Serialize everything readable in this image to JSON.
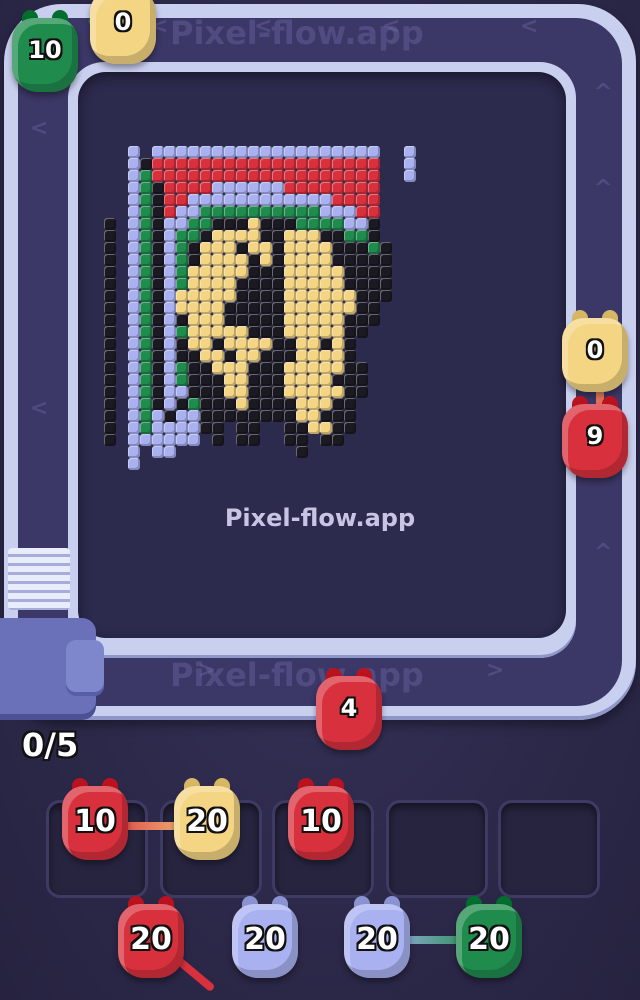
{
  "watermark": "Pixel-flow.app",
  "lane_text": "Pixel-flow.app",
  "chevrons": {
    "left": "<",
    "right": ">",
    "up": "^"
  },
  "progress": {
    "text": "0/5",
    "collected": 0,
    "total": 5
  },
  "colors": {
    "red": "#d8313d",
    "yellow": "#f4d583",
    "green": "#1f8b4d",
    "blue": "#a9b1f0",
    "black": "#1b1a22",
    "track": "#c9cfee",
    "board": "#2c2a4d"
  },
  "conveyor_pigs": [
    {
      "id": "top-yellow",
      "color": "yellow",
      "count": "0"
    },
    {
      "id": "top-green",
      "color": "green",
      "count": "10"
    },
    {
      "id": "right-yellow",
      "color": "yellow",
      "count": "0"
    },
    {
      "id": "right-red",
      "color": "red",
      "count": "9"
    },
    {
      "id": "bottom-red",
      "color": "red",
      "count": "4"
    }
  ],
  "slots": [
    {
      "pig": {
        "color": "red",
        "count": "10"
      }
    },
    {
      "pig": {
        "color": "yellow",
        "count": "20"
      }
    },
    {
      "pig": {
        "color": "red",
        "count": "10"
      }
    },
    {
      "pig": null
    },
    {
      "pig": null
    }
  ],
  "queue": [
    {
      "color": "red",
      "count": "20"
    },
    {
      "color": "blue",
      "count": "20"
    },
    {
      "color": "blue",
      "count": "20"
    },
    {
      "color": "green",
      "count": "20"
    }
  ],
  "pixel_art": {
    "palette": {
      "R": "red",
      "Y": "yellow",
      "G": "green",
      "B": "blue",
      "K": "black"
    },
    "rows": [
      "..B.BBBBBBBBBBBBBBBBBBB..B",
      "..BKRRRRRRRRRRRRRRRRRRR..B",
      "..BGRRRRRRRRRRRRRRRRRRR..B",
      "..BGKRRRRBBBBBBRRRRRRRR...",
      "..BGKRRBBBBBBBBBBBBRRRR...",
      "..BGKRBBGGGGGGGGGGBBBRR...",
      "K.BGKBBGGKKKYKKKGGGGBBK...",
      "K.BGKBGGKYYYYKKYYYKKGGK...",
      "K.BGKBGKYYYKYYKYYYYKKKGK..",
      "K.BGKBGKYYYYKYKYYYYKKKKK..",
      "K.BGKBGYYYYYKKKYYYYYKKKK..",
      "K.BGKBGYYYYKKKKYYYYYKKKK..",
      "K.BGKBYYYYYKKKKYYYYYYKKK..",
      "K.BGKBYYYYKKKKKYYYYYYKK...",
      "K.BGKBKYYYKKKKKYYYYYKKK...",
      "K.BGKBGYYYYYKKKYYYYYKK....",
      "K.BGKBKYYKYYYYKKYYKYK.....",
      "K.BGKBKKYYKYYKKKYYYYK.....",
      "K.BGKBGKKYYYKKKYYYYYKK....",
      "K.BGKBGKKKYYKKKYYYYKKK....",
      "K.BGKBBKKKYYKKKYYYYYKK....",
      "K.BGKBKGKKKYKKKKYYYKK.....",
      "K.BGBKBBKKKKKKKKYYKKK.....",
      "K.BGBBBBKK.KK..KKYYKK.....",
      "K.BBBBBB.K.KK..KK.KK......",
      "..B.BB..........K.........",
      "..B......................."
    ]
  }
}
